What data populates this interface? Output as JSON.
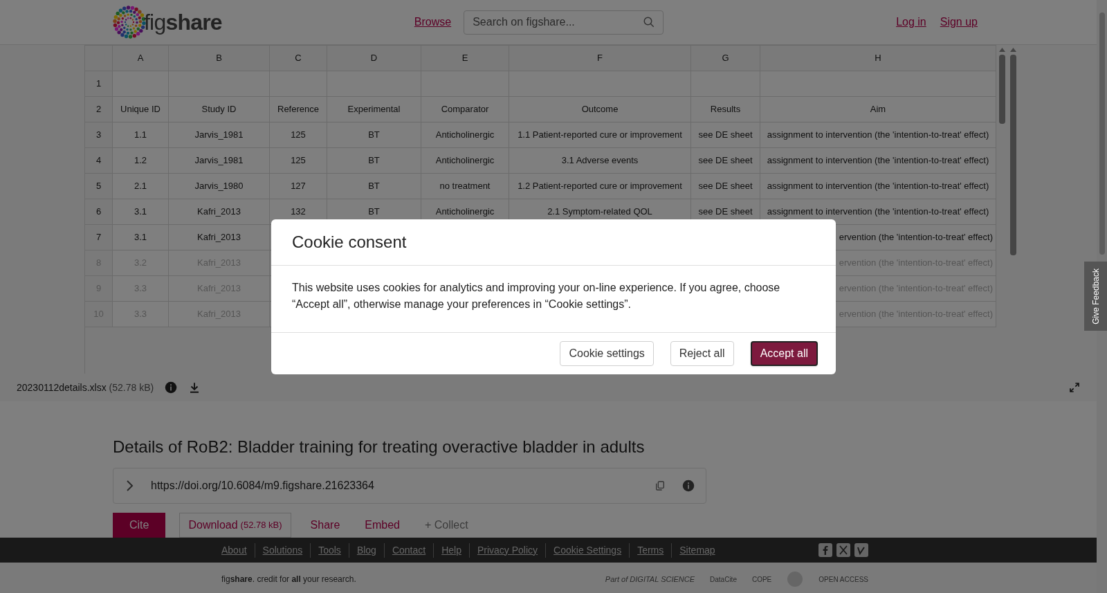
{
  "header": {
    "logo": "fig**share**",
    "nav_link": "Browse",
    "search": {
      "placeholder": "Search on figshare..."
    },
    "auth_links": [
      "Log in",
      "Sign up"
    ]
  },
  "sheet": {
    "columns": [
      "A",
      "B",
      "C",
      "D",
      "E",
      "F",
      "G",
      "H"
    ],
    "rows": [
      {
        "number": "1",
        "faded": false,
        "cells": []
      },
      {
        "number": "2",
        "faded": false,
        "cells": [
          "Unique ID",
          "Study ID",
          "Reference",
          "Experimental",
          "Comparator",
          "Outcome",
          "Results",
          "Aim"
        ]
      },
      {
        "number": "3",
        "faded": false,
        "cells": [
          "1.1",
          "Jarvis_1981",
          "125",
          "BT",
          "Anticholinergic",
          "1.1 Patient-reported cure or improvement",
          "see DE sheet",
          "assignment to intervention (the 'intention-to-treat' effect)"
        ]
      },
      {
        "number": "4",
        "faded": false,
        "cells": [
          "1.2",
          "Jarvis_1981",
          "125",
          "BT",
          "Anticholinergic",
          "3.1 Adverse events",
          "see DE sheet",
          "assignment to intervention (the 'intention-to-treat' effect)"
        ]
      },
      {
        "number": "5",
        "faded": false,
        "cells": [
          "2.1",
          "Jarvis_1980",
          "127",
          "BT",
          "no treatment",
          "1.2 Patient-reported cure or improvement",
          "see DE sheet",
          "assignment to intervention (the 'intention-to-treat' effect)"
        ]
      },
      {
        "number": "6",
        "faded": false,
        "cells": [
          "3.1",
          "Kafri_2013",
          "132",
          "BT",
          "Anticholinergic",
          "2.1 Symptom-related QOL",
          "see DE sheet",
          "assignment to intervention (the 'intention-to-treat' effect)"
        ]
      },
      {
        "number": "7",
        "faded": false,
        "cells": [
          "3.1",
          "Kafri_2013"
        ],
        "last_visible": "ervention (the 'intention-to-treat' effect)"
      },
      {
        "number": "8",
        "faded": true,
        "cells": [
          "3.2",
          "Kafri_2013"
        ],
        "last_visible": "ervention (the 'intention-to-treat' effect)"
      },
      {
        "number": "9",
        "faded": true,
        "cells": [
          "3.3",
          "Kafri_2013"
        ],
        "last_visible": "ervention (the 'intention-to-treat' effect)"
      },
      {
        "number": "10",
        "faded": true,
        "cells": [
          "3.3",
          "Kafri_2013"
        ],
        "last_visible": "ervention (the 'intention-to-treat' effect)"
      }
    ]
  },
  "file_bar": {
    "name": "20230112details.xlsx",
    "size": "(52.78 kB)"
  },
  "feedback_tab": "Give Feedback",
  "title": "Details of RoB2: Bladder training for treating overactive bladder in adults",
  "doi": "https://doi.org/10.6084/m9.figshare.21623364",
  "actions": [
    {
      "kind": "primary",
      "label": "Cite"
    },
    {
      "kind": "outline",
      "label": "Download",
      "note": "(52.78 kB)"
    },
    {
      "kind": "link",
      "label": "Share"
    },
    {
      "kind": "link",
      "label": "Embed"
    },
    {
      "kind": "muted",
      "label": "+ Collect"
    }
  ],
  "footer": {
    "links": [
      "About",
      "Solutions",
      "Tools",
      "Blog",
      "Contact",
      "Help",
      "Privacy Policy",
      "Cookie Settings",
      "Terms",
      "Sitemap"
    ],
    "tagline": "fig**share**. credit for **all** your research.",
    "partners": [
      "Part of DIGITAL SCIENCE",
      "DataCite",
      "COPE",
      "OPEN ACCESS"
    ]
  },
  "cookie_modal": {
    "title": "Cookie consent",
    "body": "This website uses cookies for analytics and improving your on-line experience. If you agree, choose “Accept all”, otherwise manage your preferences in “Cookie settings”.",
    "buttons": [
      {
        "kind": "outline",
        "label": "Cookie settings"
      },
      {
        "kind": "outline",
        "label": "Reject all"
      },
      {
        "kind": "primary",
        "label": "Accept all"
      }
    ]
  }
}
